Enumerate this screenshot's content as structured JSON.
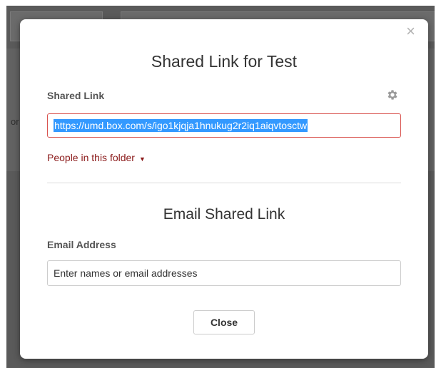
{
  "background": {
    "partial_text": "or"
  },
  "dialog": {
    "close_icon": "×",
    "title": "Shared Link for Test",
    "shared_link_label": "Shared Link",
    "settings_icon": "gear-icon",
    "shared_link_url": "https://umd.box.com/s/igo1kjqja1hnukug2r2iq1aiqvtosctw",
    "access_level": "People in this folder",
    "access_caret": "▼",
    "email_section_title": "Email Shared Link",
    "email_label": "Email Address",
    "email_placeholder": "Enter names or email addresses",
    "close_button_label": "Close"
  },
  "colors": {
    "backdrop": "#5a5a5a",
    "link_border": "#d9534f",
    "selection": "#3399ff",
    "access_text": "#8b1a1a"
  }
}
